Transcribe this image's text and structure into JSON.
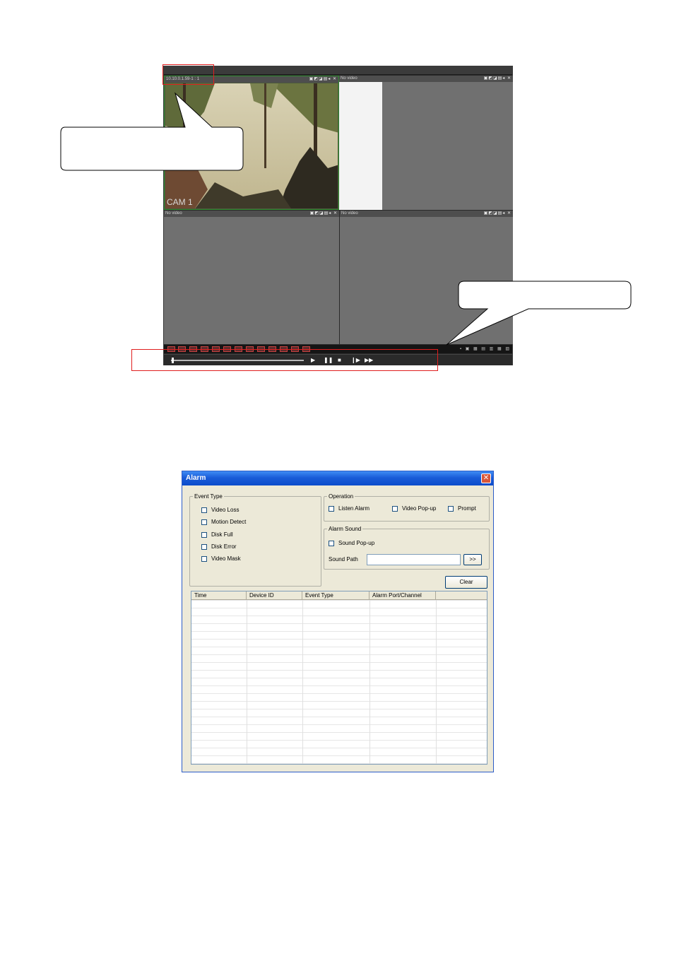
{
  "player": {
    "panes": [
      {
        "header": "10.10.0.1.59-1 : 1",
        "controls": "▣◩◪▤◂ ✕",
        "label": "CAM 1"
      },
      {
        "header": "No video",
        "controls": "▣◩◪▤◂ ✕"
      },
      {
        "header": "No video",
        "controls": "▣◩◪▤◂ ✕"
      },
      {
        "header": "No video",
        "controls": "▣◩◪▤◂ ✕"
      }
    ],
    "view_buttons": "▪ ▣ ▦ ▤ ▥ ▦ ▧",
    "playback": {
      "play": "▶",
      "pause": "❚❚",
      "stop": "■",
      "step": "❙▶",
      "fast": "▶▶"
    }
  },
  "alarm_dialog": {
    "title": "Alarm",
    "close": "✕",
    "event_type": {
      "legend": "Event Type",
      "items": [
        "Video Loss",
        "Motion Detect",
        "Disk Full",
        "Disk Error",
        "Video Mask"
      ]
    },
    "operation": {
      "legend": "Operation",
      "items": [
        "Listen Alarm",
        "Video Pop-up",
        "Prompt"
      ]
    },
    "alarm_sound": {
      "legend": "Alarm Sound",
      "sound_popup": "Sound Pop-up",
      "sound_path_label": "Sound Path",
      "sound_path_value": "",
      "browse": ">>"
    },
    "clear_button": "Clear",
    "table": {
      "columns": [
        "Time",
        "Device ID",
        "Event Type",
        "Alarm Port/Channel"
      ]
    }
  },
  "colors": {
    "annotation_red": "#e01e1e",
    "title_blue": "#1a5cd8",
    "active_pane": "#2f8a2f"
  }
}
